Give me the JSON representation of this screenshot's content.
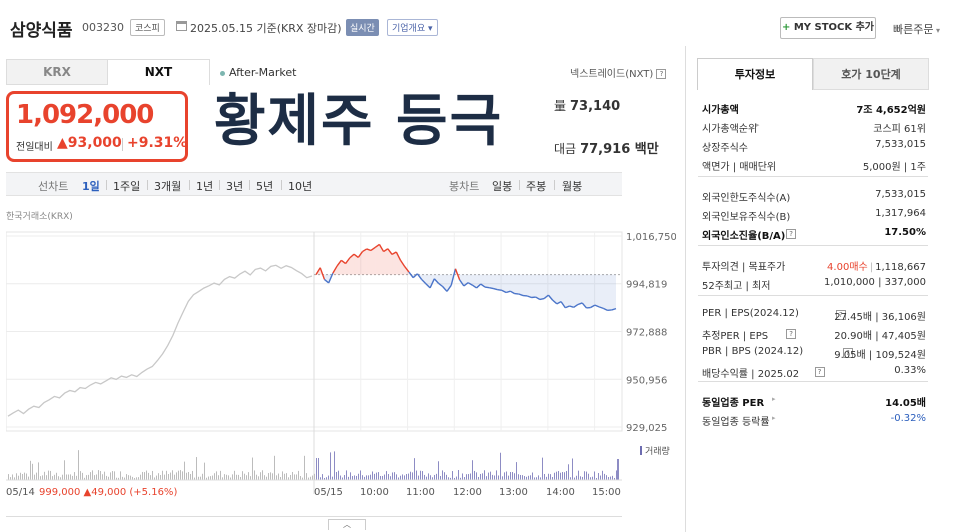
{
  "header": {
    "stock_name": "삼양식품",
    "stock_code": "003230",
    "market_badge": "코스피",
    "date_text": "2025.05.15 기준(KRX 장마감)",
    "realtime_badge": "실시간",
    "company_overview": "기업개요",
    "mystock_plus": "+",
    "mystock_label": "MY STOCK 추가",
    "quick_order": "빠른주문"
  },
  "venue_tabs": {
    "krx": "KRX",
    "nxt": "NXT"
  },
  "after_market": "After-Market",
  "nxt_note": "넥스트레이드(NXT)",
  "quote": {
    "price": "1,092,000",
    "change_label": "전일대비",
    "change": "▲93,000",
    "change_pct": "+9.31%",
    "volume_label": "量",
    "volume": "73,140",
    "amount_label": "대금",
    "amount": "77,916 백만"
  },
  "overlay_text": "황제주 등극",
  "period_bar": {
    "line_label": "선차트",
    "periods": [
      "1일",
      "1주일",
      "3개월",
      "1년",
      "3년",
      "5년",
      "10년"
    ],
    "candle_label": "봉차트",
    "candle_periods": [
      "일봉",
      "주봉",
      "월봉"
    ]
  },
  "exchange_label": "한국거래소(KRX)",
  "chart_data": {
    "type": "line",
    "y_ticks": [
      "1,016,750",
      "994,819",
      "972,888",
      "950,956",
      "929,025"
    ],
    "ylim": [
      929025,
      1016750
    ],
    "reference_price": 999000,
    "x_ticks": [
      "05/15",
      "10:00",
      "11:00",
      "12:00",
      "13:00",
      "14:00",
      "15:00"
    ],
    "x_first_label": "05/14",
    "previous_day_note": "999,000 ▲49,000 (+5.16%)",
    "volume_legend": "거래량",
    "series": [
      {
        "values": [
          934000,
          935500,
          936800,
          935200,
          937200,
          938600,
          938000,
          940300,
          941500,
          943100,
          942400,
          944600,
          945800,
          945200,
          947100,
          946700,
          948300,
          949500,
          948800,
          950200,
          951600,
          950900,
          952400,
          951800,
          953000,
          952200,
          954100,
          955600,
          956800,
          959500,
          962600,
          966400,
          971100,
          976800,
          981900,
          986700,
          989800,
          991200,
          992800,
          993900,
          995100,
          994300,
          996800,
          998100,
          997400,
          999300,
          1000600,
          998900,
          1001400,
          1002000,
          1000700,
          1002800,
          1003300,
          1001900,
          1003100,
          1002300,
          1000800,
          999500,
          997600,
          998400
        ]
      },
      {
        "values": [
          999000,
          1002200,
          996800,
          995200,
          999700,
          1003000,
          1005600,
          1004100,
          1006700,
          1008400,
          1006900,
          1009600,
          1010800,
          1010100,
          1011500,
          1012900,
          1009600,
          1010900,
          1008300,
          1009400,
          1005600,
          1002700,
          1000200,
          997600,
          999400,
          996800,
          994800,
          992900,
          997100,
          995000,
          993500,
          991300,
          994100,
          1001700,
          996600,
          993800,
          995300,
          994200,
          992900,
          994700,
          993300,
          993000,
          992600,
          992100,
          991800,
          990800,
          991400,
          990300,
          990100,
          989400,
          989200,
          988500,
          988700,
          987600,
          988000,
          989600,
          987300,
          985600,
          986600,
          983800,
          984600,
          984000,
          985300,
          986000,
          983700,
          983900,
          985000,
          984200,
          983500,
          982600,
          982800,
          983400
        ]
      }
    ]
  },
  "right_tabs": {
    "investment_info": "투자정보",
    "quote_10": "호가 10단계"
  },
  "investment": {
    "group1": [
      {
        "label": "시가총액",
        "value": "7조 4,652억원",
        "bold": true
      },
      {
        "label": "시가총액순위",
        "value": "코스피 61위",
        "arrow": true
      },
      {
        "label": "상장주식수",
        "value": "7,533,015"
      },
      {
        "label": "액면가 | 매매단위",
        "value": "5,000원 | 1주"
      }
    ],
    "group2": [
      {
        "label": "외국인한도주식수(A)",
        "value": "7,533,015"
      },
      {
        "label": "외국인보유주식수(B)",
        "value": "1,317,964"
      },
      {
        "label": "외국인소진율(B/A)",
        "value": "17.50%",
        "bold": true,
        "help": true
      }
    ],
    "group3": [
      {
        "label": "투자의견 | 목표주가",
        "value_red": "4.00매수",
        "value": "1,118,667"
      },
      {
        "label": "52주최고 | 최저",
        "value": "1,010,000 | 337,000"
      }
    ],
    "group4": [
      {
        "label": "PER | EPS(2024.12)",
        "value": "27.45배 | 36,106원",
        "help": true
      },
      {
        "label": "추정PER | EPS",
        "value": "20.90배 | 47,405원",
        "help": true
      },
      {
        "label": "PBR | BPS (2024.12)",
        "value": "9.05배 | 109,524원",
        "help": true
      },
      {
        "label": "배당수익률 | 2025.02",
        "value": "0.33%",
        "help": true
      }
    ],
    "group5": [
      {
        "label": "동일업종 PER",
        "value": "14.05배",
        "bold": true,
        "arrow": true
      },
      {
        "label": "동일업종 등락률",
        "value": "-0.32%",
        "blue": true,
        "arrow": true
      }
    ]
  },
  "colors": {
    "up": "#e8432d",
    "down": "#4a74c9",
    "accent": "#2c5fbd"
  }
}
